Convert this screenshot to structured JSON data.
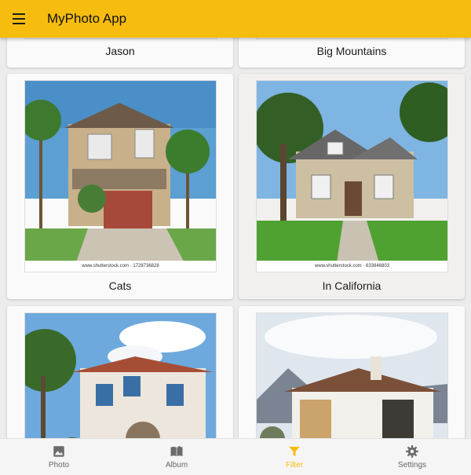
{
  "appbar": {
    "title": "MyPhoto App"
  },
  "cards": [
    {
      "caption": "Jason"
    },
    {
      "caption": "Big Mountains"
    },
    {
      "caption": "Cats",
      "credit": "www.shutterstock.com · 1728736828"
    },
    {
      "caption": "In California",
      "credit": "www.shutterstock.com · 633846803"
    },
    {
      "caption": ""
    },
    {
      "caption": ""
    }
  ],
  "nav": {
    "items": [
      {
        "label": "Photo",
        "icon": "image-icon"
      },
      {
        "label": "Album",
        "icon": "book-icon"
      },
      {
        "label": "Filter",
        "icon": "filter-icon",
        "active": true
      },
      {
        "label": "Settings",
        "icon": "gear-icon"
      }
    ]
  },
  "colors": {
    "accent": "#f7bd0e",
    "nav_inactive": "#6b6b6b"
  }
}
